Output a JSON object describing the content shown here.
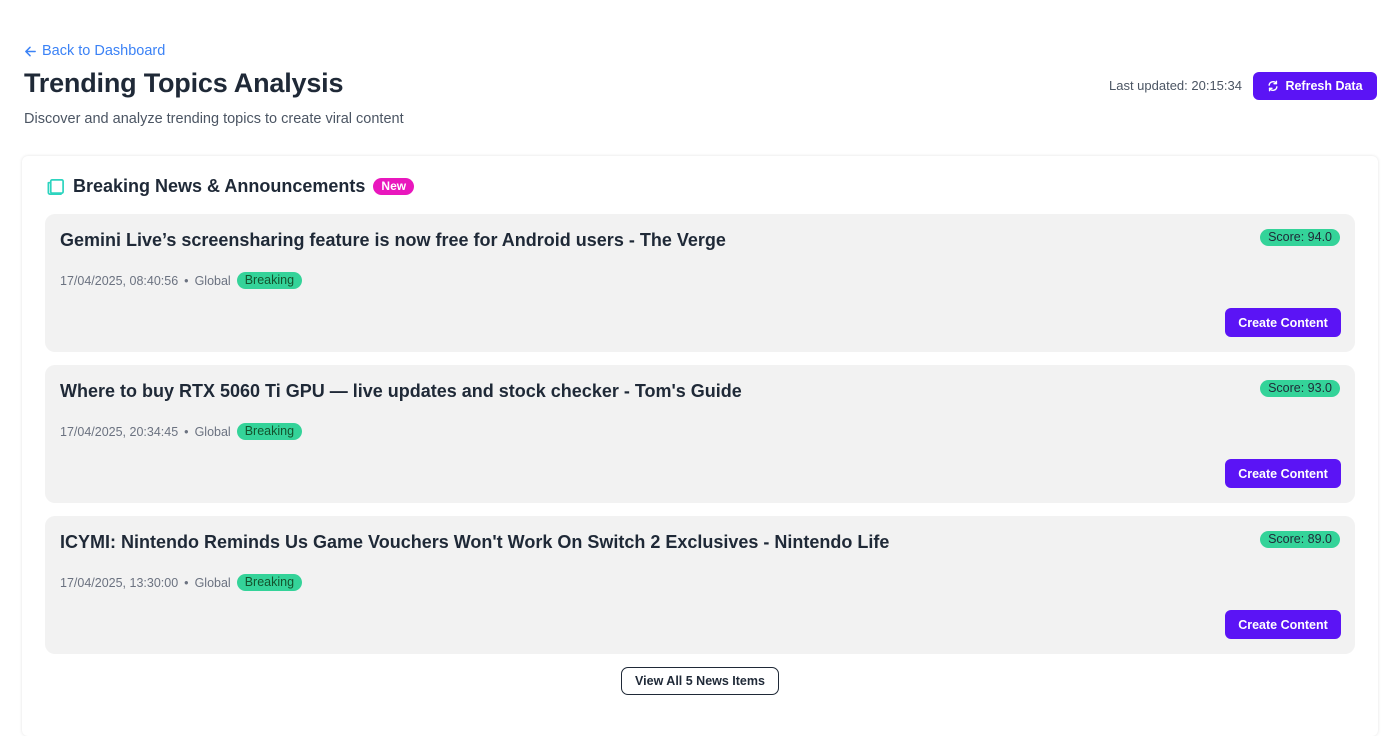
{
  "nav": {
    "back_label": "Back to Dashboard"
  },
  "header": {
    "title": "Trending Topics Analysis",
    "subtitle": "Discover and analyze trending topics to create viral content",
    "last_updated_label": "Last updated: 20:15:34",
    "refresh_label": "Refresh Data"
  },
  "section": {
    "title": "Breaking News & Announcements",
    "badge": "New",
    "icon": "news-icon",
    "items": [
      {
        "title": "Gemini Live’s screensharing feature is now free for Android users - The Verge",
        "date": "17/04/2025, 08:40:56",
        "separator": "•",
        "region": "Global",
        "tag": "Breaking",
        "score": "Score: 94.0",
        "action": "Create Content"
      },
      {
        "title": "Where to buy RTX 5060 Ti GPU — live updates and stock checker - Tom's Guide",
        "date": "17/04/2025, 20:34:45",
        "separator": "•",
        "region": "Global",
        "tag": "Breaking",
        "score": "Score: 93.0",
        "action": "Create Content"
      },
      {
        "title": "ICYMI: Nintendo Reminds Us Game Vouchers Won't Work On Switch 2 Exclusives - Nintendo Life",
        "date": "17/04/2025, 13:30:00",
        "separator": "•",
        "region": "Global",
        "tag": "Breaking",
        "score": "Score: 89.0",
        "action": "Create Content"
      }
    ],
    "view_all_label": "View All 5 News Items"
  },
  "colors": {
    "accent": "#5b14f5",
    "link": "#3b82f6",
    "badge_new": "#e917bd",
    "tag_green": "#34d399",
    "icon_teal": "#2dd4bf"
  }
}
